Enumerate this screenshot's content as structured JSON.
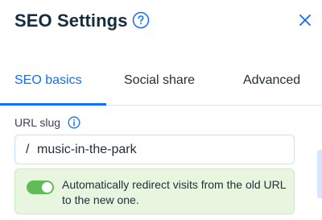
{
  "header": {
    "title": "SEO Settings",
    "help_icon": "question-circle-icon",
    "close_icon": "close-icon"
  },
  "tabs": [
    {
      "label": "SEO basics",
      "active": true
    },
    {
      "label": "Social share",
      "active": false
    },
    {
      "label": "Advanced",
      "active": false
    }
  ],
  "url_slug": {
    "label": "URL slug",
    "info_icon": "info-icon",
    "prefix": "/",
    "value": "music-in-the-park"
  },
  "redirect": {
    "enabled": true,
    "text": "Automatically redirect visits from the old URL to the new one."
  },
  "colors": {
    "accent": "#116dff",
    "toggle_on": "#60bc57",
    "notice_bg": "#e8f6e0"
  }
}
